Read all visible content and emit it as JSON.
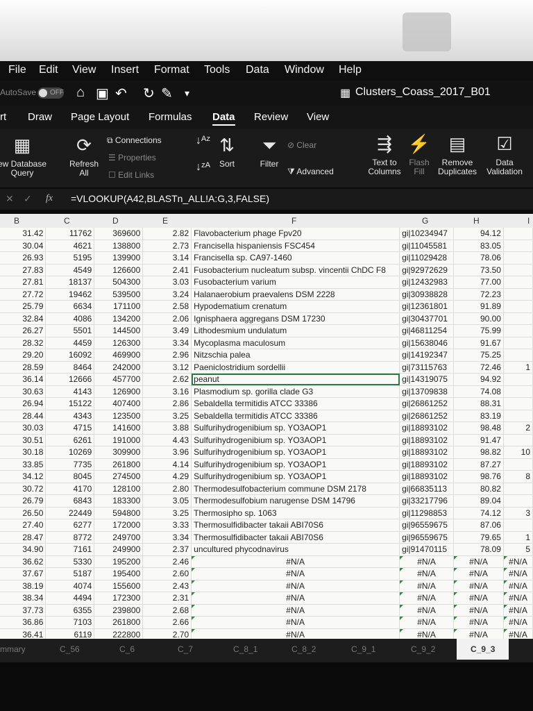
{
  "menu": [
    "File",
    "Edit",
    "View",
    "Insert",
    "Format",
    "Tools",
    "Data",
    "Window",
    "Help"
  ],
  "titlebar": {
    "autosave": "AutoSave",
    "toggle": "OFF",
    "doc_title": "Clusters_Coass_2017_B01"
  },
  "tabs": [
    "rt",
    "Draw",
    "Page Layout",
    "Formulas",
    "Data",
    "Review",
    "View"
  ],
  "ribbon": {
    "new_db_query": "ew Database\nQuery",
    "refresh_all": "Refresh\nAll",
    "connections": "Connections",
    "properties": "Properties",
    "edit_links": "Edit Links",
    "sort": "Sort",
    "filter": "Filter",
    "clear": "Clear",
    "advanced": "Advanced",
    "text_to_columns": "Text to\nColumns",
    "flash_fill": "Flash\nFill",
    "remove_duplicates": "Remove\nDuplicates",
    "data_validation": "Data\nValidation"
  },
  "formula_bar": {
    "fx": "fx",
    "formula": "=VLOOKUP(A42,BLASTn_ALL!A:G,3,FALSE)"
  },
  "columns": [
    "B",
    "C",
    "D",
    "E",
    "F",
    "G",
    "H",
    "I"
  ],
  "rows": [
    [
      "31.42",
      "11762",
      "369600",
      "2.82",
      "Flavobacterium phage Fpv20",
      "gi|10234947",
      "94.12",
      ""
    ],
    [
      "30.04",
      "4621",
      "138800",
      "2.73",
      "Francisella hispaniensis FSC454",
      "gi|11045581",
      "83.05",
      ""
    ],
    [
      "26.93",
      "5195",
      "139900",
      "3.14",
      "Francisella sp. CA97-1460",
      "gi|11029428",
      "78.06",
      ""
    ],
    [
      "27.83",
      "4549",
      "126600",
      "2.41",
      "Fusobacterium nucleatum subsp. vincentii ChDC F8",
      "gi|92972629",
      "73.50",
      ""
    ],
    [
      "27.81",
      "18137",
      "504300",
      "3.03",
      "Fusobacterium varium",
      "gi|12432983",
      "77.00",
      ""
    ],
    [
      "27.72",
      "19462",
      "539500",
      "3.24",
      "Halanaerobium praevalens DSM 2228",
      "gi|30938828",
      "72.23",
      ""
    ],
    [
      "25.79",
      "6634",
      "171100",
      "2.58",
      "Hypodematium crenatum",
      "gi|12361801",
      "91.89",
      ""
    ],
    [
      "32.84",
      "4086",
      "134200",
      "2.06",
      "Ignisphaera aggregans DSM 17230",
      "gi|30437701",
      "90.00",
      ""
    ],
    [
      "26.27",
      "5501",
      "144500",
      "3.49",
      "Lithodesmium undulatum",
      "gi|46811254",
      "75.99",
      ""
    ],
    [
      "28.32",
      "4459",
      "126300",
      "3.34",
      "Mycoplasma maculosum",
      "gi|15638046",
      "91.67",
      ""
    ],
    [
      "29.20",
      "16092",
      "469900",
      "2.96",
      "Nitzschia palea",
      "gi|14192347",
      "75.25",
      ""
    ],
    [
      "28.59",
      "8464",
      "242000",
      "3.12",
      "Paeniclostridium sordellii",
      "gi|73115763",
      "72.46",
      "1"
    ],
    [
      "36.14",
      "12666",
      "457700",
      "2.62",
      "peanut",
      "gi|14319075",
      "94.92",
      ""
    ],
    [
      "30.63",
      "4143",
      "126900",
      "3.16",
      "Plasmodium sp. gorilla clade G3",
      "gi|13709838",
      "74.08",
      ""
    ],
    [
      "26.94",
      "15122",
      "407400",
      "2.86",
      "Sebaldella termitidis ATCC 33386",
      "gi|26861252",
      "88.31",
      ""
    ],
    [
      "28.44",
      "4343",
      "123500",
      "3.25",
      "Sebaldella termitidis ATCC 33386",
      "gi|26861252",
      "83.19",
      ""
    ],
    [
      "30.03",
      "4715",
      "141600",
      "3.88",
      "Sulfurihydrogenibium sp. YO3AOP1",
      "gi|18893102",
      "98.48",
      "2"
    ],
    [
      "30.51",
      "6261",
      "191000",
      "4.43",
      "Sulfurihydrogenibium sp. YO3AOP1",
      "gi|18893102",
      "91.47",
      ""
    ],
    [
      "30.18",
      "10269",
      "309900",
      "3.96",
      "Sulfurihydrogenibium sp. YO3AOP1",
      "gi|18893102",
      "98.82",
      "10"
    ],
    [
      "33.85",
      "7735",
      "261800",
      "4.14",
      "Sulfurihydrogenibium sp. YO3AOP1",
      "gi|18893102",
      "87.27",
      ""
    ],
    [
      "34.12",
      "8045",
      "274500",
      "4.29",
      "Sulfurihydrogenibium sp. YO3AOP1",
      "gi|18893102",
      "98.76",
      "8"
    ],
    [
      "30.72",
      "4170",
      "128100",
      "2.80",
      "Thermodesulfobacterium commune DSM 2178",
      "gi|66835113",
      "80.82",
      ""
    ],
    [
      "26.79",
      "6843",
      "183300",
      "3.05",
      "Thermodesulfobium narugense DSM 14796",
      "gi|33217796",
      "89.04",
      ""
    ],
    [
      "26.50",
      "22449",
      "594800",
      "3.25",
      "Thermosipho sp. 1063",
      "gi|11298853",
      "74.12",
      "3"
    ],
    [
      "27.40",
      "6277",
      "172000",
      "3.33",
      "Thermosulfidibacter takaii ABI70S6",
      "gi|96559675",
      "87.06",
      ""
    ],
    [
      "28.47",
      "8772",
      "249700",
      "3.34",
      "Thermosulfidibacter takaii ABI70S6",
      "gi|96559675",
      "79.65",
      "1"
    ],
    [
      "34.90",
      "7161",
      "249900",
      "2.37",
      "uncultured phycodnavirus",
      "gi|91470115",
      "78.09",
      "5"
    ],
    [
      "36.62",
      "5330",
      "195200",
      "2.46",
      "#N/A",
      "#N/A",
      "#N/A",
      "#N/A"
    ],
    [
      "37.67",
      "5187",
      "195400",
      "2.60",
      "#N/A",
      "#N/A",
      "#N/A",
      "#N/A"
    ],
    [
      "38.19",
      "4074",
      "155600",
      "2.43",
      "#N/A",
      "#N/A",
      "#N/A",
      "#N/A"
    ],
    [
      "38.34",
      "4494",
      "172300",
      "2.31",
      "#N/A",
      "#N/A",
      "#N/A",
      "#N/A"
    ],
    [
      "37.73",
      "6355",
      "239800",
      "2.68",
      "#N/A",
      "#N/A",
      "#N/A",
      "#N/A"
    ],
    [
      "36.86",
      "7103",
      "261800",
      "2.66",
      "#N/A",
      "#N/A",
      "#N/A",
      "#N/A"
    ],
    [
      "36.41",
      "6119",
      "222800",
      "2.70",
      "#N/A",
      "#N/A",
      "#N/A",
      "#N/A"
    ]
  ],
  "sheet_tabs": [
    "mmary",
    "C_56",
    "C_6",
    "C_7",
    "C_8_1",
    "C_8_2",
    "C_9_1",
    "C_9_2",
    "C_9_3"
  ],
  "active_sheet": "C_9_3"
}
